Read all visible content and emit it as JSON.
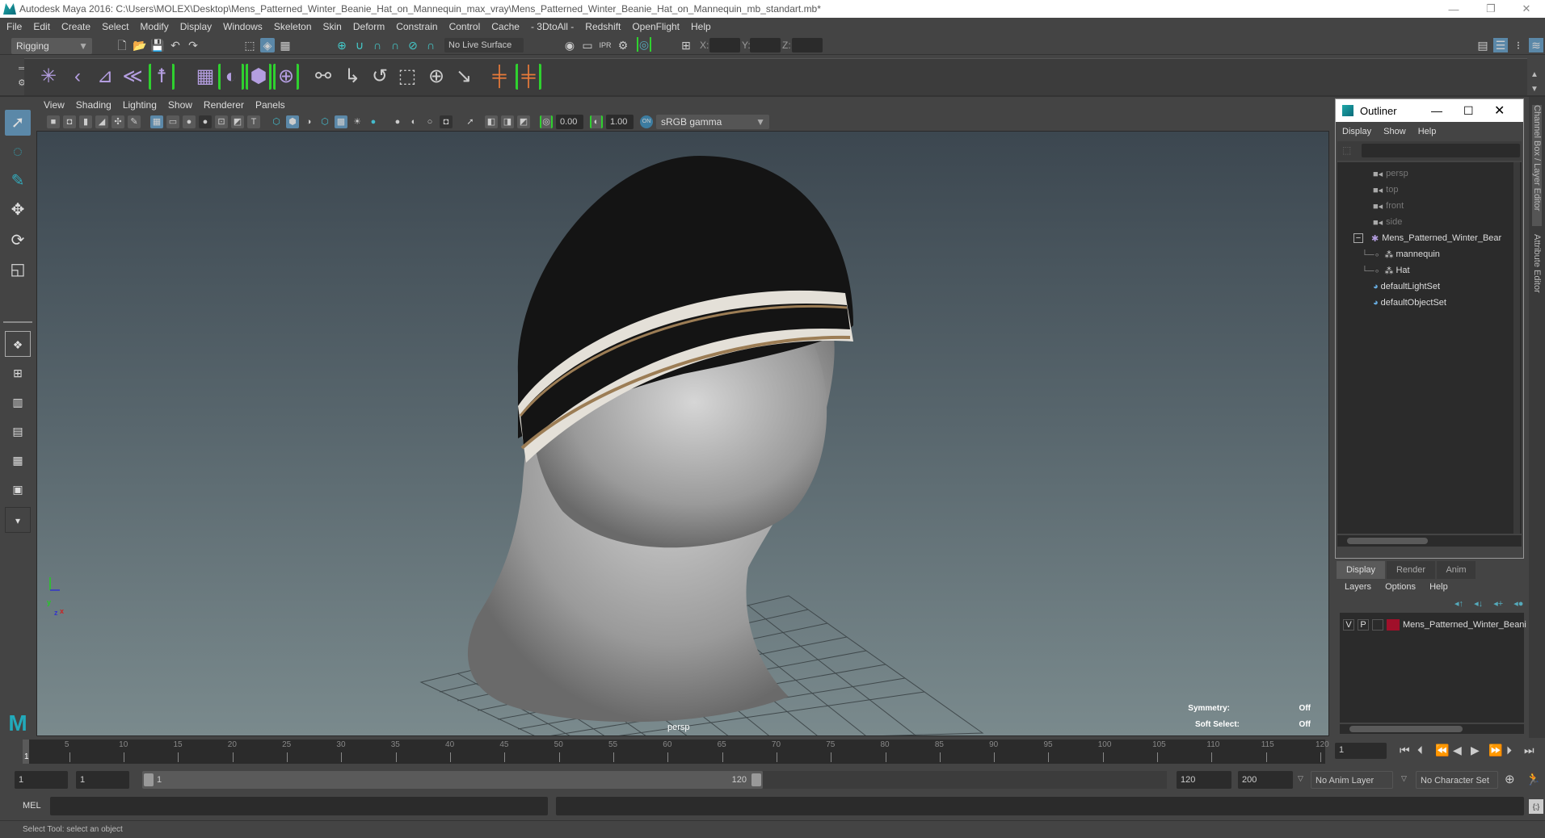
{
  "window": {
    "title": "Autodesk Maya 2016: C:\\Users\\MOLEX\\Desktop\\Mens_Patterned_Winter_Beanie_Hat_on_Mannequin_max_vray\\Mens_Patterned_Winter_Beanie_Hat_on_Mannequin_mb_standart.mb*",
    "minimize": "—",
    "restore": "❐",
    "close": "✕"
  },
  "menubar": [
    "File",
    "Edit",
    "Create",
    "Select",
    "Modify",
    "Display",
    "Windows",
    "Skeleton",
    "Skin",
    "Deform",
    "Constrain",
    "Control",
    "Cache",
    "- 3DtoAll -",
    "Redshift",
    "OpenFlight",
    "Help"
  ],
  "statusline": {
    "menuset": "Rigging",
    "live_surface": "No Live Surface",
    "x_label": "X:",
    "y_label": "Y:",
    "z_label": "Z:",
    "x_value": "",
    "y_value": "",
    "z_value": ""
  },
  "viewport": {
    "menu": [
      "View",
      "Shading",
      "Lighting",
      "Show",
      "Renderer",
      "Panels"
    ],
    "exposure": "0.00",
    "gamma": "1.00",
    "color_space": "sRGB gamma",
    "camera_label": "persp",
    "hud": {
      "symmetry_label": "Symmetry:",
      "symmetry_value": "Off",
      "soft_select_label": "Soft Select:",
      "soft_select_value": "Off"
    },
    "axis": {
      "x": "x",
      "y": "y",
      "z": "z"
    }
  },
  "outliner": {
    "title": "Outliner",
    "menu": [
      "Display",
      "Show",
      "Help"
    ],
    "search": "",
    "items": [
      {
        "label": "persp",
        "type": "camera",
        "dim": true
      },
      {
        "label": "top",
        "type": "camera",
        "dim": true
      },
      {
        "label": "front",
        "type": "camera",
        "dim": true
      },
      {
        "label": "side",
        "type": "camera",
        "dim": true
      },
      {
        "label": "Mens_Patterned_Winter_Bear",
        "type": "group",
        "expanded": true
      },
      {
        "label": "mannequin",
        "type": "mesh",
        "child": true
      },
      {
        "label": "Hat",
        "type": "mesh",
        "child": true
      },
      {
        "label": "defaultLightSet",
        "type": "set"
      },
      {
        "label": "defaultObjectSet",
        "type": "set"
      }
    ]
  },
  "layer_editor": {
    "tabs": [
      "Display",
      "Render",
      "Anim"
    ],
    "active_tab": "Display",
    "menu": [
      "Layers",
      "Options",
      "Help"
    ],
    "layers": [
      {
        "v": "V",
        "p": "P",
        "color": "#a0102a",
        "name": "Mens_Patterned_Winter_Beani"
      }
    ]
  },
  "side_tabs": [
    "Channel Box / Layer Editor",
    "Attribute Editor"
  ],
  "timeline": {
    "ticks": [
      5,
      10,
      15,
      20,
      25,
      30,
      35,
      40,
      45,
      50,
      55,
      60,
      65,
      70,
      75,
      80,
      85,
      90,
      95,
      100,
      105,
      110,
      115,
      120
    ],
    "current_frame_marker": "1",
    "current_frame": "1",
    "min": 1,
    "max": 120
  },
  "range": {
    "start": "1",
    "playback_start": "1",
    "slider_start": "1",
    "slider_end": "120",
    "playback_end": "120",
    "end": "200",
    "anim_layer": "No Anim Layer",
    "character_set": "No Character Set"
  },
  "command_line": {
    "label": "MEL",
    "value": "",
    "result": ""
  },
  "help_line": "Select Tool: select an object"
}
